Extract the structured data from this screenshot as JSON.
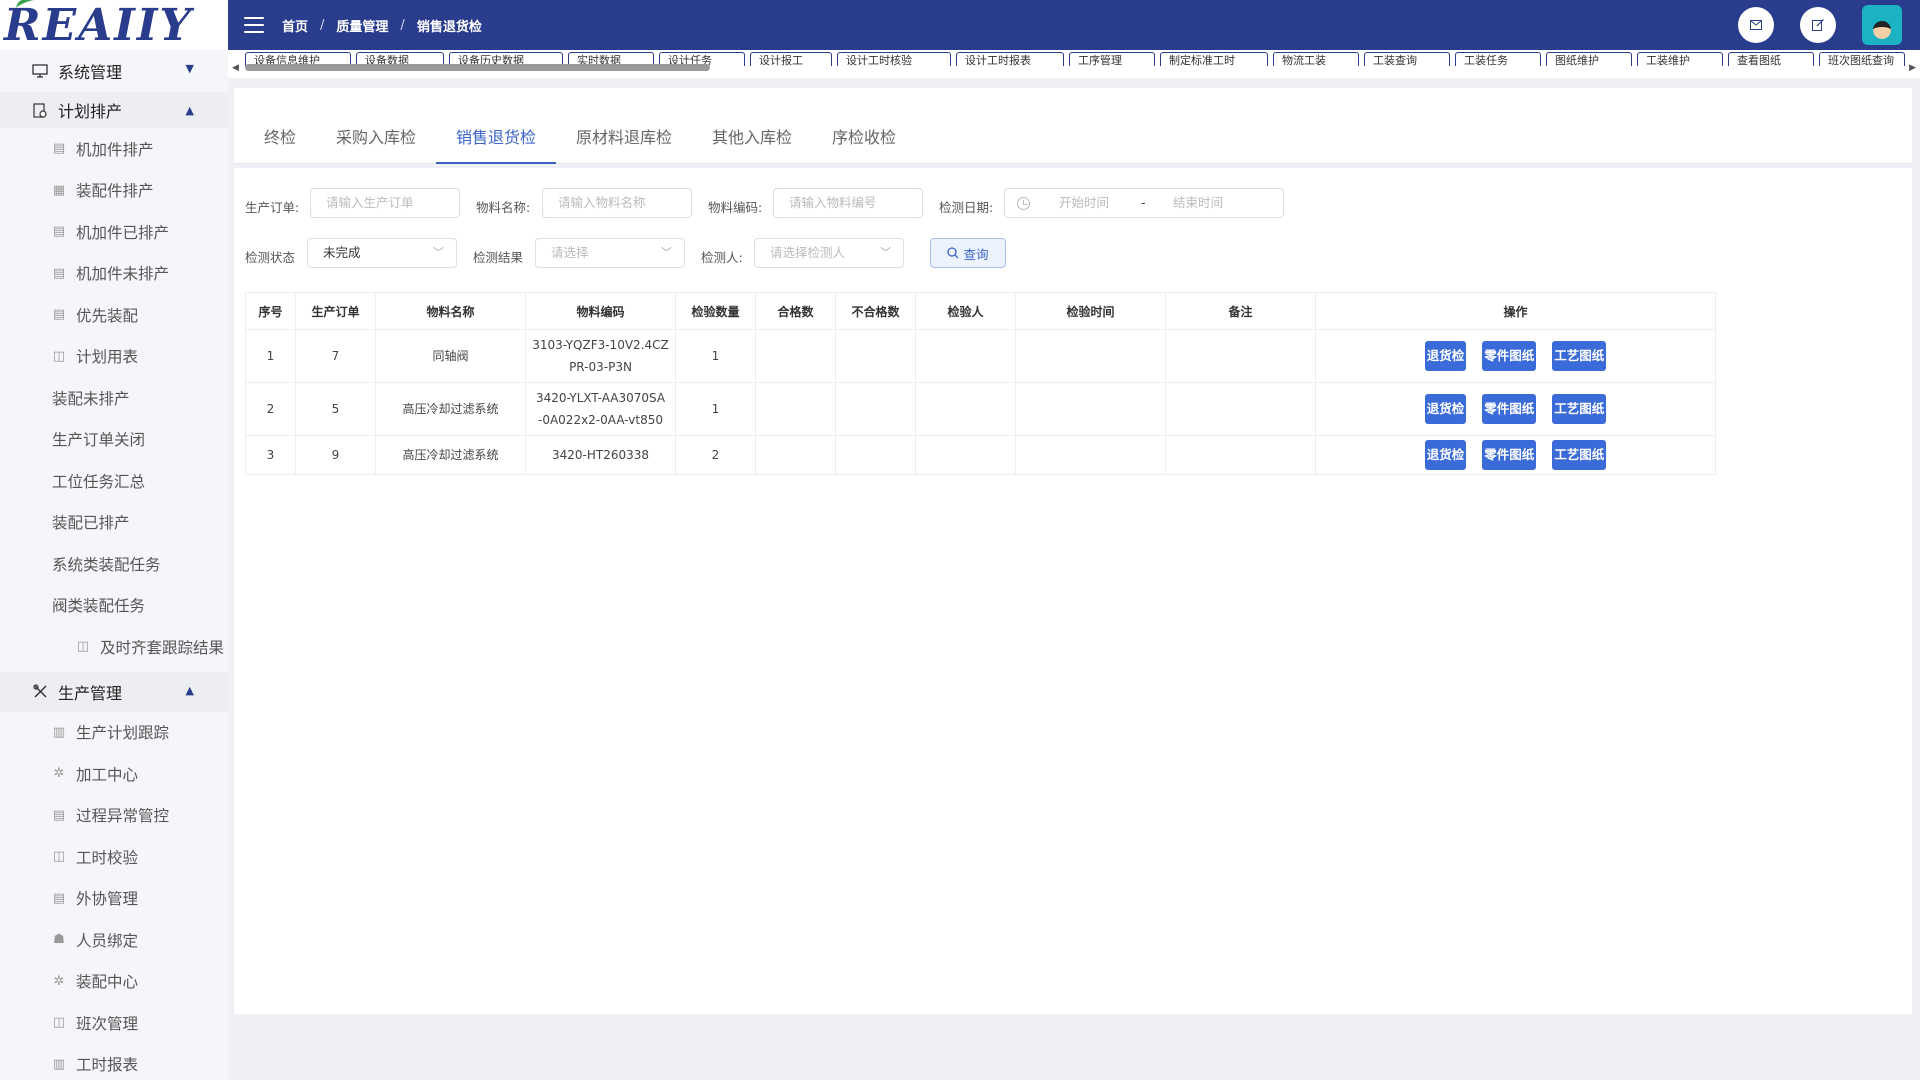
{
  "logo": {
    "text": "REAIIY"
  },
  "sidebar": {
    "groups": [
      {
        "label": "系统管理",
        "arrow": "▼"
      },
      {
        "label": "计划排产",
        "arrow": "▲"
      },
      {
        "label": "生产管理",
        "arrow": "▲"
      }
    ],
    "plan_items": [
      "机加件排产",
      "装配件排产",
      "机加件已排产",
      "机加件未排产",
      "优先装配",
      "计划用表",
      "装配未排产",
      "生产订单关闭",
      "工位任务汇总",
      "装配已排产",
      "系统类装配任务",
      "阀类装配任务",
      "及时齐套跟踪结果"
    ],
    "prod_items": [
      "生产计划跟踪",
      "加工中心",
      "过程异常管控",
      "工时校验",
      "外协管理",
      "人员绑定",
      "装配中心",
      "班次管理",
      "工时报表"
    ]
  },
  "topbar": {
    "breadcrumb": [
      "首页",
      "质量管理",
      "销售退货检"
    ],
    "sep": "/"
  },
  "tags": [
    "设备信息维护",
    "设备数据",
    "设备历史数据",
    "实时数据",
    "设计任务",
    "设计报工",
    "设计工时核验",
    "设计工时报表",
    "工序管理",
    "制定标准工时",
    "物流工装",
    "工装查询",
    "工装任务",
    "图纸维护",
    "工装维护",
    "查看图纸",
    "班次图纸查询"
  ],
  "quality_tabs": [
    "终检",
    "采购入库检",
    "销售退货检",
    "原材料退库检",
    "其他入库检",
    "序检收检"
  ],
  "filters": {
    "order_label": "生产订单:",
    "order_placeholder": "请输入生产订单",
    "material_name_label": "物料名称:",
    "material_name_placeholder": "请输入物料名称",
    "material_code_label": "物料编码:",
    "material_code_placeholder": "请输入物料编号",
    "date_label": "检测日期:",
    "date_start": "开始时间",
    "date_sep": "-",
    "date_end": "结束时间",
    "status_label": "检测状态",
    "status_value": "未完成",
    "result_label": "检测结果",
    "result_placeholder": "请选择",
    "inspector_label": "检测人:",
    "inspector_placeholder": "请选择检测人",
    "query_button": "查询"
  },
  "table": {
    "headers": [
      "序号",
      "生产订单",
      "物料名称",
      "物料编码",
      "检验数量",
      "合格数",
      "不合格数",
      "检验人",
      "检验时间",
      "备注",
      "操作"
    ],
    "rows": [
      {
        "no": "1",
        "order": "7",
        "name": "同轴阀",
        "code_1": "3103-YQZF3-10V2.4CZ",
        "code_2": "PR-03-P3N",
        "qty": "1",
        "pass": "",
        "fail": "",
        "inspector": "",
        "time": "",
        "remark": ""
      },
      {
        "no": "2",
        "order": "5",
        "name": "高压冷却过滤系统",
        "code_1": "3420-YLXT-AA3070SA",
        "code_2": "-0A022x2-0AA-vt850",
        "qty": "1",
        "pass": "",
        "fail": "",
        "inspector": "",
        "time": "",
        "remark": ""
      },
      {
        "no": "3",
        "order": "9",
        "name": "高压冷却过滤系统",
        "code_1": "3420-HT260338",
        "code_2": "",
        "qty": "2",
        "pass": "",
        "fail": "",
        "inspector": "",
        "time": "",
        "remark": ""
      }
    ],
    "actions": [
      "退货检",
      "零件图纸",
      "工艺图纸"
    ]
  }
}
